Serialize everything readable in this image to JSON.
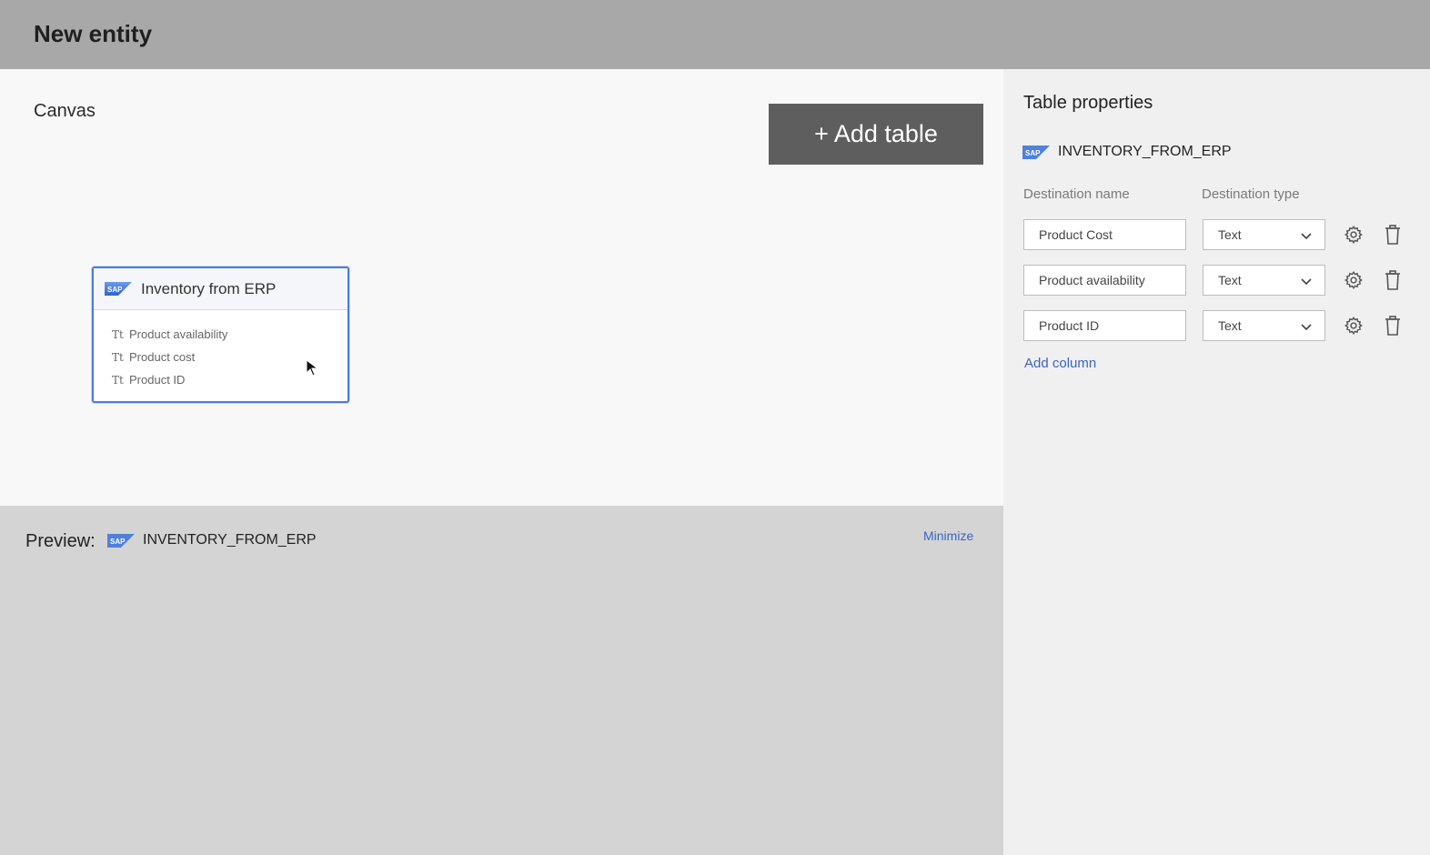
{
  "header": {
    "title": "New entity"
  },
  "canvas": {
    "title": "Canvas",
    "add_table_label": "+ Add table",
    "table_card": {
      "title": "Inventory from ERP",
      "field_icon": "Tt",
      "fields": [
        "Product availability",
        "Product cost",
        "Product ID"
      ]
    }
  },
  "preview": {
    "label": "Preview:",
    "source_name": "INVENTORY_FROM_ERP",
    "minimize_label": "Minimize"
  },
  "properties": {
    "title": "Table properties",
    "source_name": "INVENTORY_FROM_ERP",
    "col_destination_name": "Destination name",
    "col_destination_type": "Destination type",
    "rows": [
      {
        "name": "Product Cost",
        "type": "Text"
      },
      {
        "name": "Product availability",
        "type": "Text"
      },
      {
        "name": "Product ID",
        "type": "Text"
      }
    ],
    "add_column_label": "Add column"
  },
  "icons": {
    "brand_logo": "sap-logo-icon",
    "settings": "gear-icon",
    "delete": "trash-icon",
    "dropdown": "chevron-down-icon",
    "cursor": "mouse-pointer-icon"
  },
  "colors": {
    "accent": "#4a7be0",
    "link": "#3a66c4",
    "header_bg": "#a8a8a8",
    "button_bg": "#5e5e5e"
  }
}
